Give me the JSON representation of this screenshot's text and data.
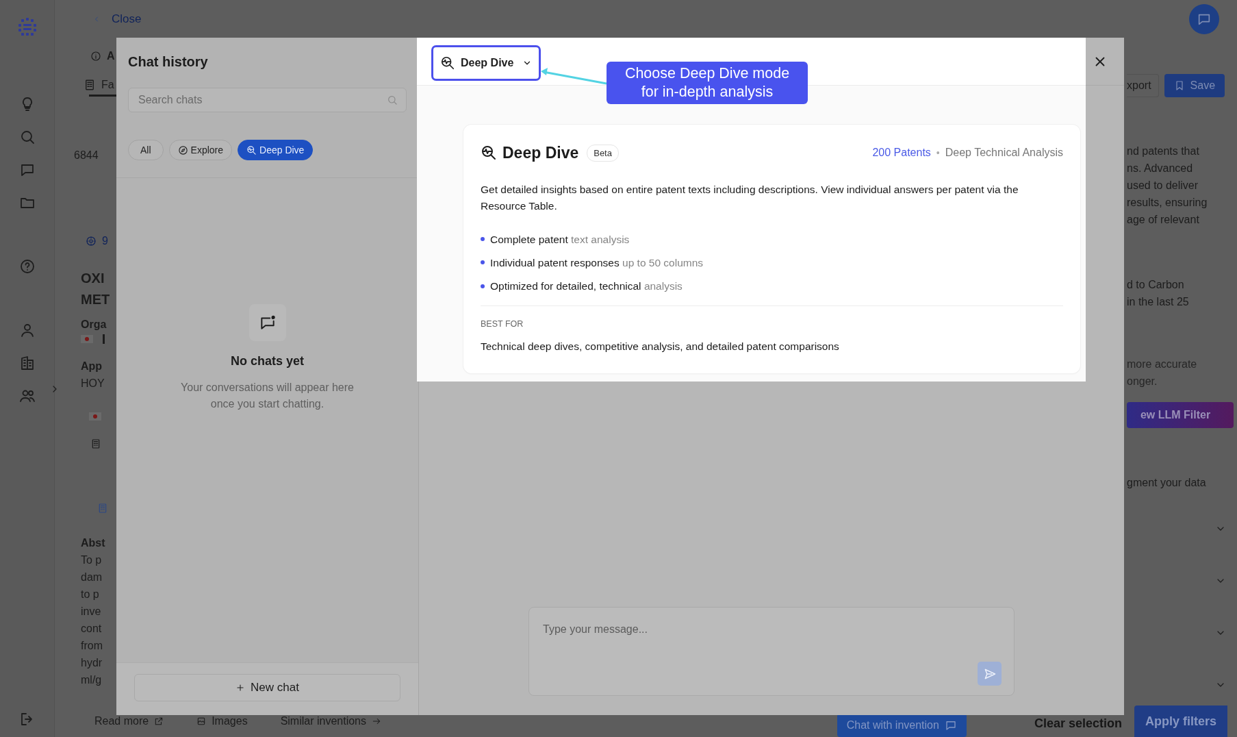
{
  "background": {
    "back_link": "Close",
    "info_label": "A",
    "tab_label": "Fa",
    "result_count": "6844",
    "result_number": "9",
    "title_lines": [
      "OXI",
      "MET"
    ],
    "org_label": "Orga",
    "applicant_label": "App",
    "applicant_value": "HOY",
    "abstract_label": "Abst",
    "abstract_lines": [
      "To p",
      "dam",
      "to p",
      "inve",
      "cont",
      "from",
      "hydr",
      "ml/g"
    ],
    "toolbar_buttons": [
      "xport",
      "Save"
    ],
    "description_lines": [
      "nd patents that",
      "ns. Advanced",
      "used to deliver",
      "results, ensuring",
      "age of relevant"
    ],
    "query_lines": [
      "d to Carbon",
      "in the last 25"
    ],
    "hint_lines": [
      "more accurate",
      "onger."
    ],
    "llm_button": "ew LLM Filter",
    "augment_text": "gment your data",
    "footer": {
      "links": [
        "Read more",
        "Images",
        "Similar inventions"
      ],
      "chat_button": "Chat with invention",
      "clear_button": "Clear selection",
      "apply_button": "Apply filters"
    }
  },
  "chat_history": {
    "title": "Chat history",
    "search": {
      "placeholder": "Search chats"
    },
    "filters": [
      {
        "label": "All",
        "kind": "plain",
        "selected": false
      },
      {
        "label": "Explore",
        "kind": "explore",
        "selected": false
      },
      {
        "label": "Deep Dive",
        "kind": "deep",
        "selected": true
      }
    ],
    "empty_title": "No chats yet",
    "empty_text": "Your conversations will appear here once you start chatting.",
    "new_chat": "New chat"
  },
  "mode_menu": {
    "selected_mode": "Deep Dive",
    "card": {
      "title": "Deep Dive",
      "badge": "Beta",
      "patents": "200 Patents",
      "separator": "•",
      "subtitle": "Deep Technical Analysis",
      "description": "Get detailed insights based on entire patent texts including descriptions. View individual answers per patent via the Resource Table.",
      "features": [
        {
          "text": "Complete patent",
          "detail": "text analysis"
        },
        {
          "text": "Individual patent responses",
          "detail": "up to 50 columns"
        },
        {
          "text": "Optimized for detailed, technical",
          "detail": "analysis"
        }
      ],
      "best_for_label": "BEST FOR",
      "best_for": "Technical deep dives, competitive analysis, and detailed patent comparisons"
    }
  },
  "callout": "Choose Deep Dive mode for in-depth analysis",
  "composer": {
    "placeholder": "Type your message..."
  }
}
